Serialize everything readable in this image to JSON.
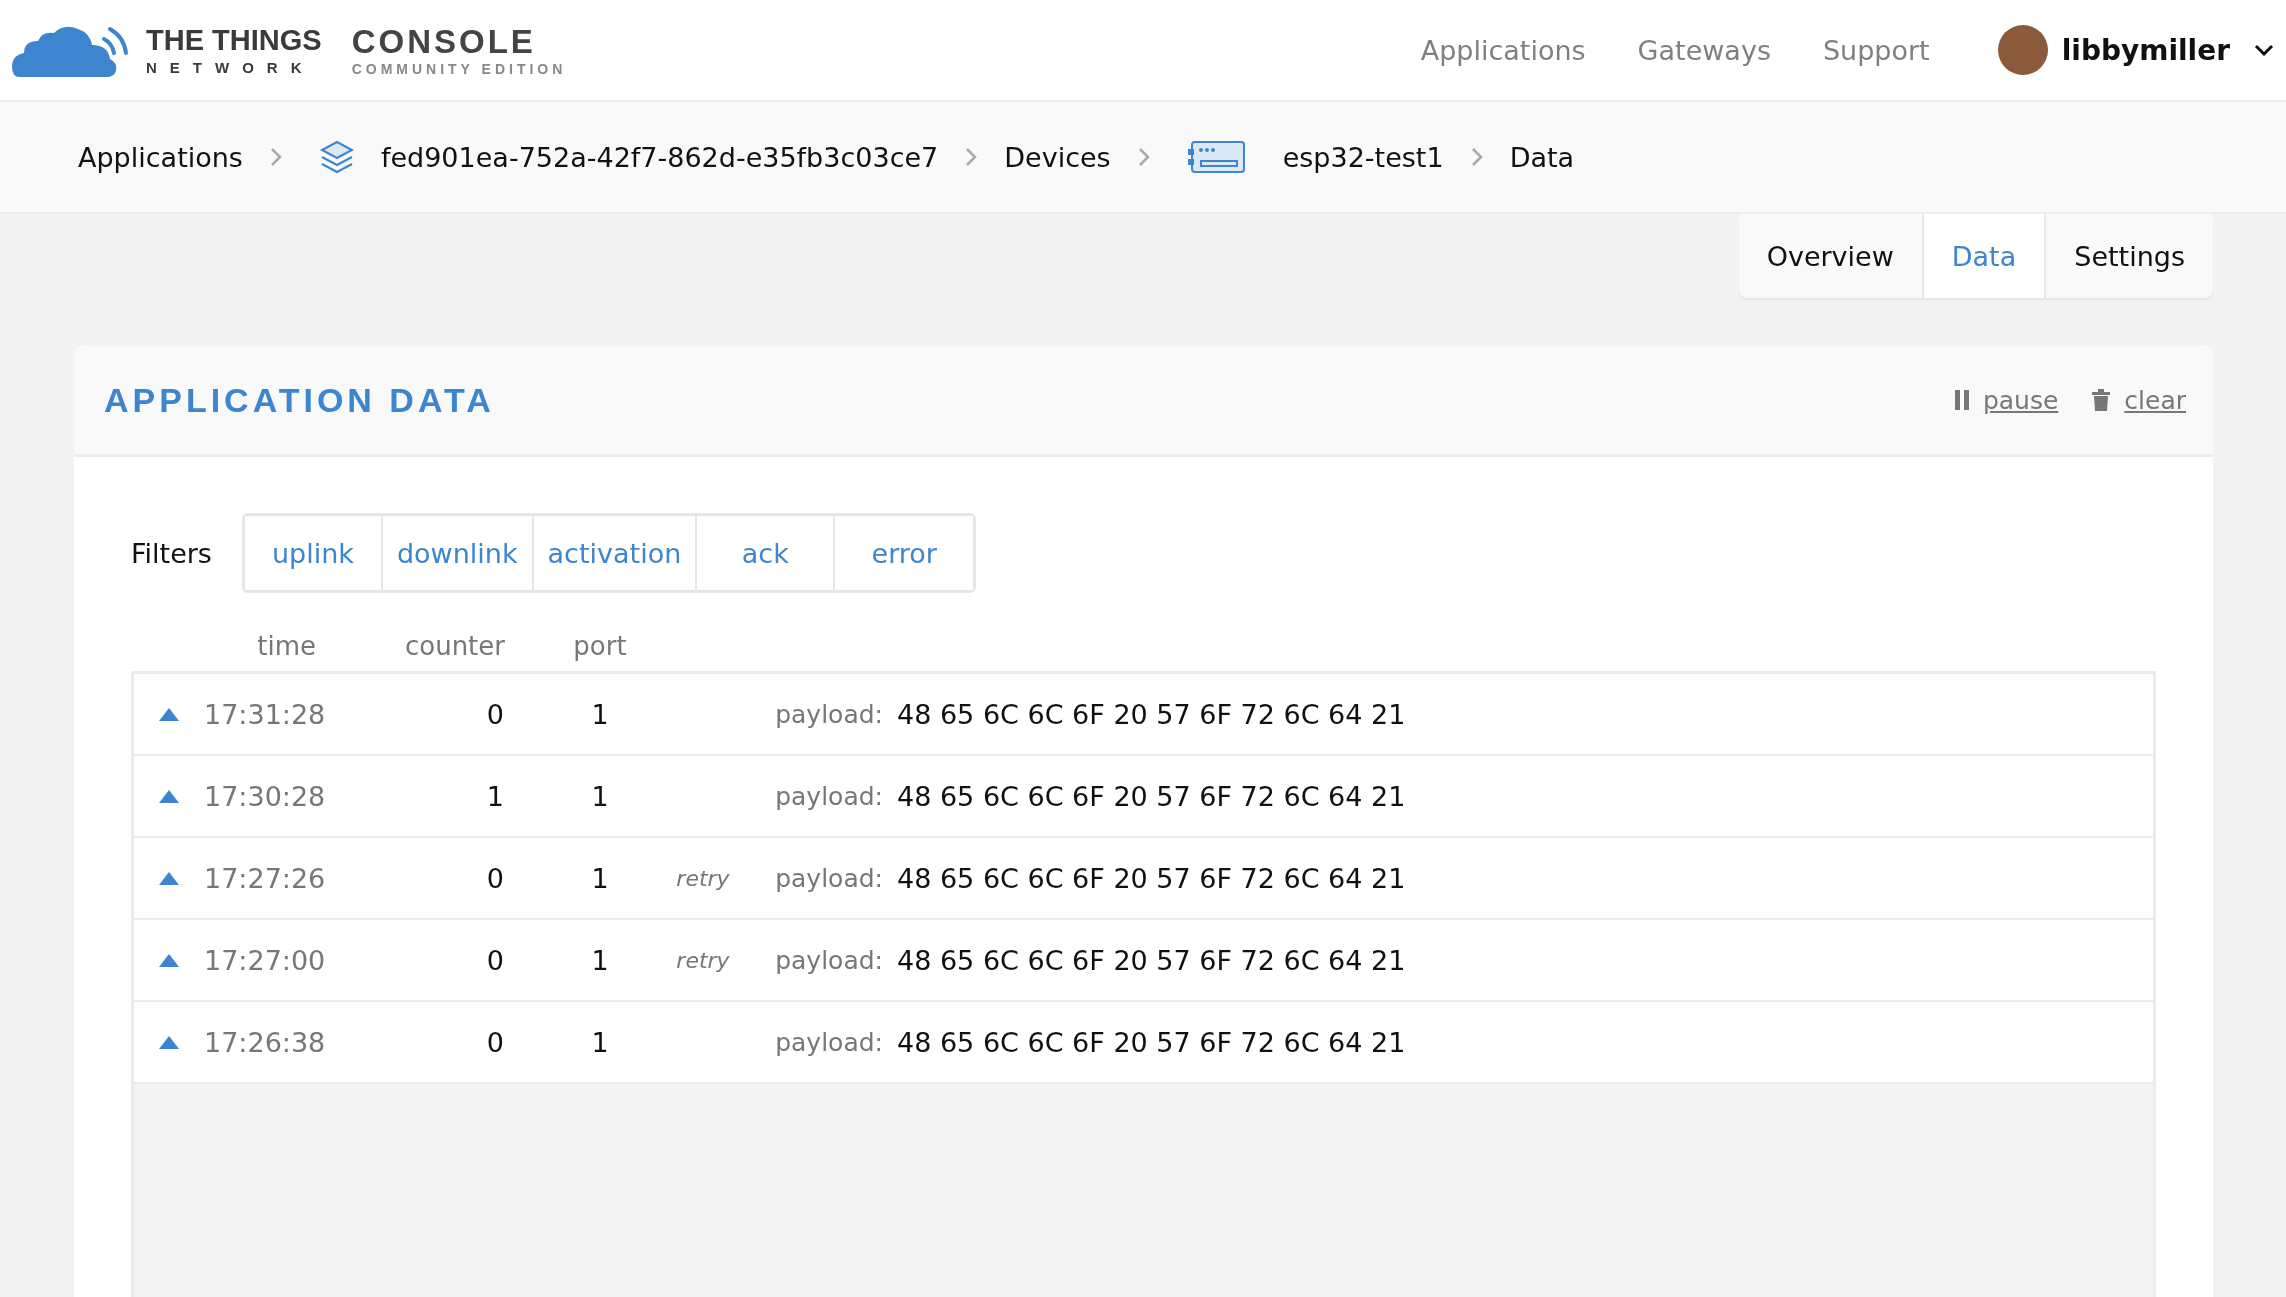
{
  "logo": {
    "brand_top": "THE THINGS",
    "brand_bottom": "NETWORK",
    "product": "CONSOLE",
    "edition": "COMMUNITY EDITION"
  },
  "nav": [
    "Applications",
    "Gateways",
    "Support"
  ],
  "user": {
    "name": "libbymiller"
  },
  "breadcrumb": [
    {
      "label": "Applications",
      "kind": "text"
    },
    {
      "label": "fed901ea-752a-42f7-862d-e35fb3c03ce7",
      "kind": "application"
    },
    {
      "label": "Devices",
      "kind": "text"
    },
    {
      "label": "esp32-test1",
      "kind": "device"
    },
    {
      "label": "Data",
      "kind": "text"
    }
  ],
  "tabs": [
    {
      "label": "Overview",
      "selected": false
    },
    {
      "label": "Data",
      "selected": true
    },
    {
      "label": "Settings",
      "selected": false
    }
  ],
  "panel": {
    "title": "APPLICATION DATA",
    "actions": [
      {
        "label": "pause",
        "kind": "pause"
      },
      {
        "label": "clear",
        "kind": "clear"
      }
    ]
  },
  "filters": {
    "label": "Filters",
    "options": [
      "uplink",
      "downlink",
      "activation",
      "ack",
      "error"
    ]
  },
  "table": {
    "columns": [
      "time",
      "counter",
      "port"
    ],
    "rows": [
      {
        "time": "17:31:28",
        "counter": "0",
        "port": "1",
        "payload_label": "payload:",
        "payload": "48 65 6C 6C 6F 20 57 6F 72 6C 64 21"
      },
      {
        "time": "17:30:28",
        "counter": "1",
        "port": "1",
        "payload_label": "payload:",
        "payload": "48 65 6C 6C 6F 20 57 6F 72 6C 64 21"
      },
      {
        "time": "17:27:26",
        "counter": "0",
        "port": "1",
        "note": "retry",
        "payload_label": "payload:",
        "payload": "48 65 6C 6C 6F 20 57 6F 72 6C 64 21"
      },
      {
        "time": "17:27:00",
        "counter": "0",
        "port": "1",
        "note": "retry",
        "payload_label": "payload:",
        "payload": "48 65 6C 6C 6F 20 57 6F 72 6C 64 21"
      },
      {
        "time": "17:26:38",
        "counter": "0",
        "port": "1",
        "payload_label": "payload:",
        "payload": "48 65 6C 6C 6F 20 57 6F 72 6C 64 21"
      }
    ]
  }
}
